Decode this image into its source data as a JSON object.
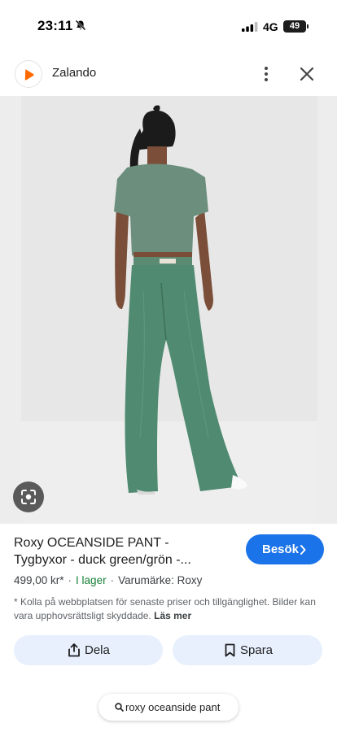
{
  "status_bar": {
    "time": "23:11",
    "network": "4G",
    "battery": "49"
  },
  "header": {
    "site_name": "Zalando",
    "logo_color": "#ff6900"
  },
  "product": {
    "title_line1": "Roxy OCEANSIDE PANT -",
    "title_line2": "Tygbyxor - duck green/grön -...",
    "price": "499,00 kr*",
    "stock": "I lager",
    "brand": "Varumärke: Roxy",
    "disclaimer": "* Kolla på webbplatsen för senaste priser och tillgänglighet. Bilder kan vara upphovsrättsligt skyddade.",
    "learn_more": "Läs mer"
  },
  "actions": {
    "visit": "Besök",
    "share": "Dela",
    "save": "Spara"
  },
  "search": {
    "query": "roxy oceanside pant"
  },
  "colors": {
    "accent": "#1a73e8",
    "chip_bg": "#e8f0fe",
    "stock_green": "#188038",
    "garment_green": "#4f8a71"
  },
  "icons": [
    "bell-off-icon",
    "signal-icon",
    "battery-icon",
    "zalando-logo",
    "more-vert-icon",
    "close-icon",
    "lens-icon",
    "chevron-right-icon",
    "share-icon",
    "bookmark-icon",
    "search-icon"
  ]
}
